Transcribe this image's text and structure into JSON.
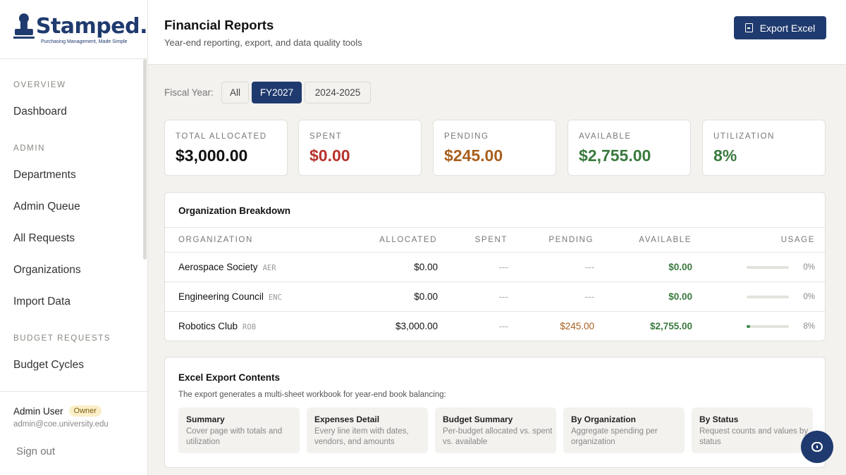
{
  "brand": {
    "name": "Stamped.",
    "tagline": "Purchasing Management, Made Simple"
  },
  "sidebar": {
    "sections": [
      {
        "label": "OVERVIEW",
        "items": [
          "Dashboard"
        ]
      },
      {
        "label": "ADMIN",
        "items": [
          "Departments",
          "Admin Queue",
          "All Requests",
          "Organizations",
          "Import Data"
        ]
      },
      {
        "label": "BUDGET REQUESTS",
        "items": [
          "Budget Cycles"
        ]
      }
    ],
    "user": {
      "name": "Admin User",
      "role": "Owner",
      "email": "admin@coe.university.edu"
    },
    "signout_label": "Sign out"
  },
  "header": {
    "title": "Financial Reports",
    "subtitle": "Year-end reporting, export, and data quality tools",
    "export_label": "Export Excel"
  },
  "fiscal_year": {
    "label": "Fiscal Year:",
    "options": [
      "All",
      "FY2027",
      "2024-2025"
    ],
    "selected": "FY2027"
  },
  "stats": [
    {
      "label": "TOTAL ALLOCATED",
      "value": "$3,000.00",
      "color": "#111111"
    },
    {
      "label": "SPENT",
      "value": "$0.00",
      "color": "#b8322c"
    },
    {
      "label": "PENDING",
      "value": "$245.00",
      "color": "#a8601e"
    },
    {
      "label": "AVAILABLE",
      "value": "$2,755.00",
      "color": "#3a7a3e"
    },
    {
      "label": "UTILIZATION",
      "value": "8%",
      "color": "#3a7a3e"
    }
  ],
  "breakdown": {
    "title": "Organization Breakdown",
    "columns": [
      "ORGANIZATION",
      "ALLOCATED",
      "SPENT",
      "PENDING",
      "AVAILABLE",
      "USAGE"
    ],
    "rows": [
      {
        "name": "Aerospace Society",
        "code": "AER",
        "allocated": "$0.00",
        "spent": "---",
        "pending": "---",
        "available": "$0.00",
        "usage_label": "0%",
        "usage": 0
      },
      {
        "name": "Engineering Council",
        "code": "ENC",
        "allocated": "$0.00",
        "spent": "---",
        "pending": "---",
        "available": "$0.00",
        "usage_label": "0%",
        "usage": 0
      },
      {
        "name": "Robotics Club",
        "code": "ROB",
        "allocated": "$3,000.00",
        "spent": "---",
        "pending": "$245.00",
        "available": "$2,755.00",
        "usage_label": "8%",
        "usage": 0.08
      }
    ]
  },
  "export_contents": {
    "title": "Excel Export Contents",
    "description": "The export generates a multi-sheet workbook for year-end book balancing:",
    "sheets": [
      {
        "title": "Summary",
        "desc": "Cover page with totals and utilization"
      },
      {
        "title": "Expenses Detail",
        "desc": "Every line item with dates, vendors, and amounts"
      },
      {
        "title": "Budget Summary",
        "desc": "Per-budget allocated vs. spent vs. available"
      },
      {
        "title": "By Organization",
        "desc": "Aggregate spending per organization"
      },
      {
        "title": "By Status",
        "desc": "Request counts and values by status"
      }
    ]
  },
  "colors": {
    "brand": "#1f3a6e",
    "green": "#3a7a3e",
    "red": "#b8322c",
    "amber": "#a8601e"
  }
}
